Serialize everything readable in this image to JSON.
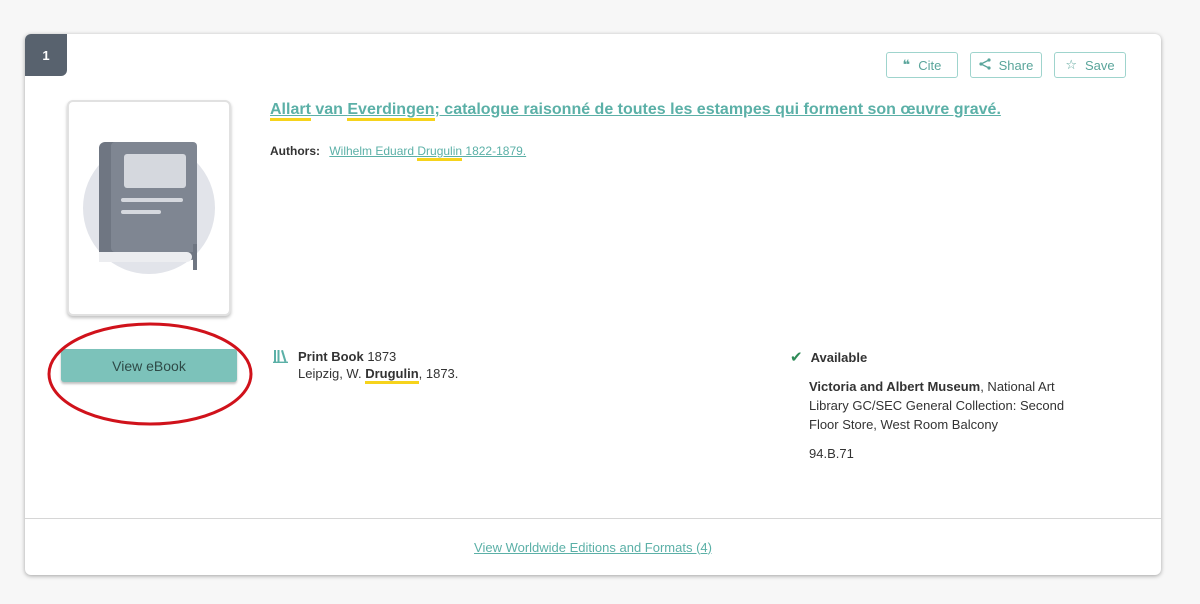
{
  "result": {
    "index": "1",
    "title_parts": [
      "Allart",
      " van ",
      "Everdingen",
      "; catalogue raisonné de toutes les estampes qui forment son œuvre gravé."
    ],
    "authors_label": "Authors:",
    "author_parts": [
      "Wilhelm Eduard ",
      "Drugulin",
      " 1822-1879."
    ],
    "view_ebook_label": "View eBook",
    "actions": {
      "cite_label": "Cite",
      "share_label": "Share",
      "save_label": "Save"
    },
    "format": {
      "type_label": "Print Book",
      "year": "1873",
      "publisher_parts": [
        "Leipzig, W. ",
        "Drugulin",
        ", 1873."
      ]
    },
    "availability": {
      "status": "Available",
      "library_name": "Victoria and Albert Museum",
      "location": ", National Art Library GC/SEC General Collection: Second Floor Store, West Room Balcony",
      "call_number": "94.B.71"
    },
    "editions_link": "View Worldwide Editions and Formats (4)"
  },
  "colors": {
    "accent": "#5bb0a7",
    "button": "#7cc2ba",
    "badge": "#58626e",
    "highlight": "#f6d31c",
    "annotation": "#d0121b"
  },
  "icons": {
    "cite": "quote-icon",
    "share": "share-icon",
    "save": "star-icon",
    "format": "books-icon",
    "availability": "check-icon"
  }
}
